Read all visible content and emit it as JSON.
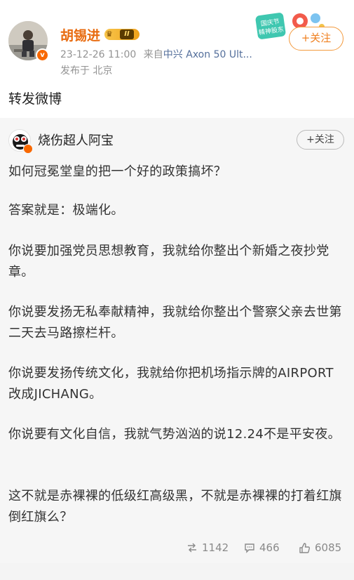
{
  "post": {
    "author": "胡锡进",
    "vip_level": "II",
    "timestamp": "23-12-26 11:00",
    "source_prefix": "来自",
    "device": "中兴 Axon 50 Ult...",
    "location": "发布于 北京",
    "follow_label": "+关注",
    "text": "转发微博",
    "festival_banner_text": "国庆节 精神股东"
  },
  "quoted": {
    "author": "烧伤超人阿宝",
    "follow_label": "+关注",
    "paragraphs": [
      "如何冠冕堂皇的把一个好的政策搞坏？",
      "答案就是：极端化。",
      "你说要加强党员思想教育，我就给你整出个新婚之夜抄党章。",
      "你说要发扬无私奉献精神，我就给你整出个警察父亲去世第二天去马路擦栏杆。",
      "你说要发扬传统文化，我就给你把机场指示牌的AIRPORT改成JICHANG。",
      "你说要有文化自信，我就气势汹汹的说12.24不是平安夜。",
      "这不就是赤裸裸的低级红高级黑，不就是赤裸裸的打着红旗倒红旗么？"
    ],
    "stats": {
      "reposts": "1142",
      "comments": "466",
      "likes": "6085"
    }
  },
  "colors": {
    "author_orange": "#e86b0f",
    "follow_orange": "#f08020",
    "device_blue": "#546f9b",
    "verified_badge": "#f86800"
  }
}
